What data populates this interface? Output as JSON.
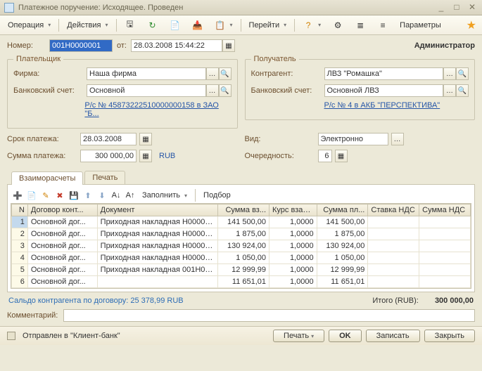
{
  "window_title": "Платежное поручение: Исходящее. Проведен",
  "toolbar": {
    "operation": "Операция",
    "actions": "Действия",
    "go": "Перейти",
    "params": "Параметры"
  },
  "header": {
    "number_label": "Номер:",
    "number": "001H0000001",
    "from_label": "от:",
    "date": "28.03.2008 15:44:22",
    "user": "Администратор"
  },
  "payer": {
    "legend": "Плательщик",
    "firm_label": "Фирма:",
    "firm": "Наша фирма",
    "account_label": "Банковский счет:",
    "account": "Основной",
    "details": "Р/с № 45873222510000000158 в ЗАО \"Б..."
  },
  "payee": {
    "legend": "Получатель",
    "contragent_label": "Контрагент:",
    "contragent": "ЛВЗ \"Ромашка\"",
    "account_label": "Банковский счет:",
    "account": "Основной ЛВЗ",
    "details": "Р/с № 4 в АКБ \"ПЕРСПЕКТИВА\""
  },
  "middle": {
    "due_label": "Срок платежа:",
    "due_date": "28.03.2008",
    "sum_label": "Сумма платежа:",
    "sum": "300 000,00",
    "currency": "RUB",
    "kind_label": "Вид:",
    "kind": "Электронно",
    "queue_label": "Очередность:",
    "queue": "6"
  },
  "tabs": {
    "settlements": "Взаиморасчеты",
    "print": "Печать"
  },
  "gridbar": {
    "fill": "Заполнить",
    "select": "Подбор"
  },
  "grid": {
    "headers": {
      "n": "N",
      "contract": "Договор конт...",
      "doc": "Документ",
      "sum_vz": "Сумма вз...",
      "rate": "Курс взаи...",
      "sum_pl": "Сумма пл...",
      "nds_rate": "Ставка НДС",
      "nds_sum": "Сумма НДС"
    },
    "rows": [
      {
        "n": "1",
        "contract": "Основной дог...",
        "doc": "Приходная накладная H00000...",
        "sum_vz": "141 500,00",
        "rate": "1,0000",
        "sum_pl": "141 500,00",
        "nds_rate": "",
        "nds_sum": ""
      },
      {
        "n": "2",
        "contract": "Основной дог...",
        "doc": "Приходная накладная H00000...",
        "sum_vz": "1 875,00",
        "rate": "1,0000",
        "sum_pl": "1 875,00",
        "nds_rate": "",
        "nds_sum": ""
      },
      {
        "n": "3",
        "contract": "Основной дог...",
        "doc": "Приходная накладная H00000...",
        "sum_vz": "130 924,00",
        "rate": "1,0000",
        "sum_pl": "130 924,00",
        "nds_rate": "",
        "nds_sum": ""
      },
      {
        "n": "4",
        "contract": "Основной дог...",
        "doc": "Приходная накладная H00000...",
        "sum_vz": "1 050,00",
        "rate": "1,0000",
        "sum_pl": "1 050,00",
        "nds_rate": "",
        "nds_sum": ""
      },
      {
        "n": "5",
        "contract": "Основной дог...",
        "doc": "Приходная накладная 001H00...",
        "sum_vz": "12 999,99",
        "rate": "1,0000",
        "sum_pl": "12 999,99",
        "nds_rate": "",
        "nds_sum": ""
      },
      {
        "n": "6",
        "contract": "Основной дог...",
        "doc": "",
        "sum_vz": "11 651,01",
        "rate": "1,0000",
        "sum_pl": "11 651,01",
        "nds_rate": "",
        "nds_sum": ""
      }
    ]
  },
  "summary": {
    "balance": "Сальдо контрагента по договору: 25 378,99 RUB",
    "total_label": "Итого (RUB):",
    "total": "300 000,00"
  },
  "comment_label": "Комментарий:",
  "comment": "",
  "footer": {
    "sent_to_bank": "Отправлен в \"Клиент-банк\"",
    "print": "Печать",
    "ok": "OK",
    "save": "Записать",
    "close": "Закрыть"
  }
}
